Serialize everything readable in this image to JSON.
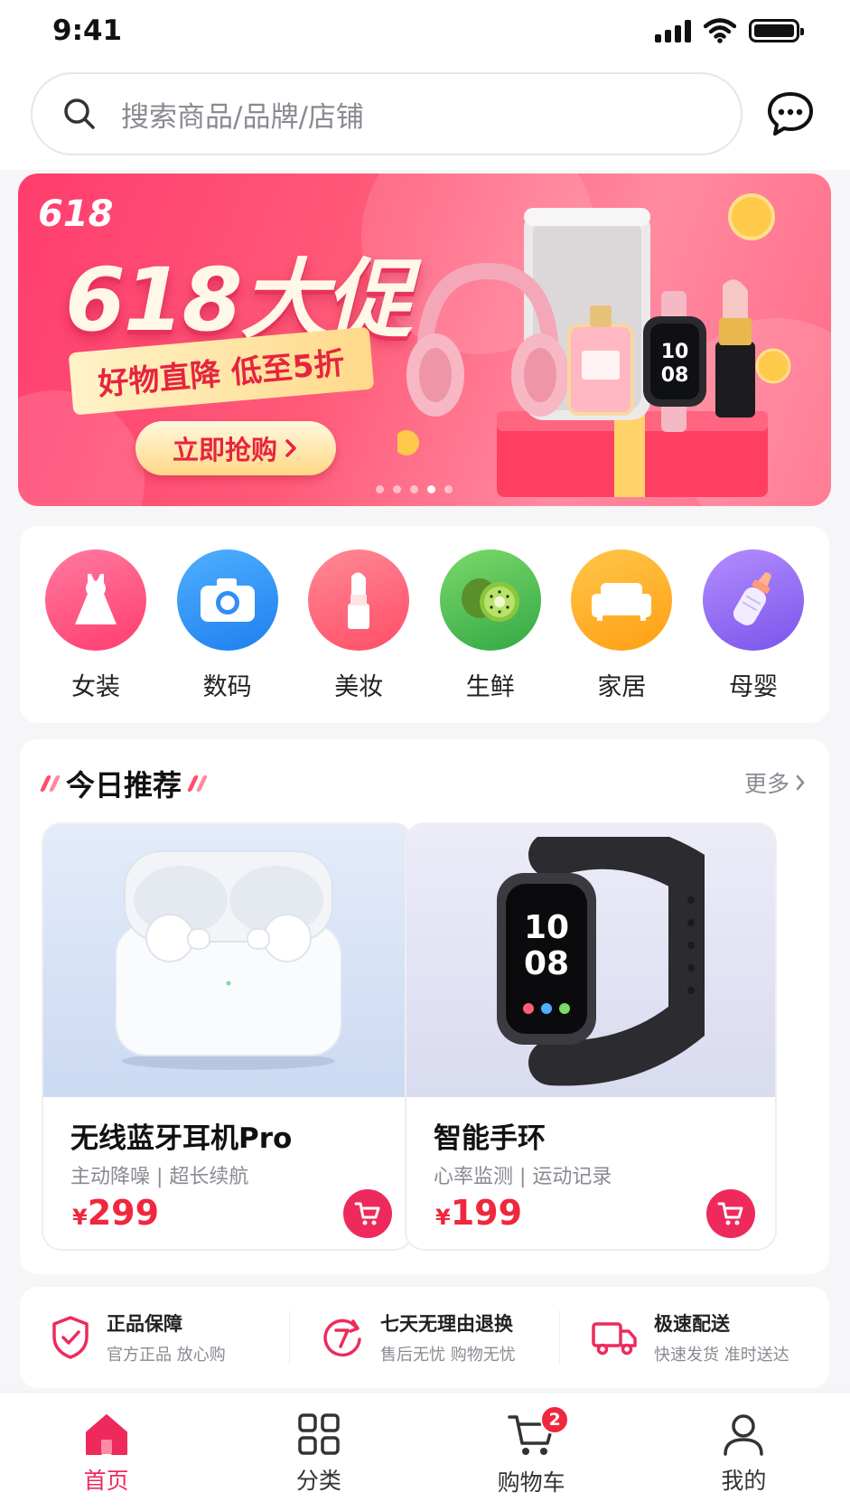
{
  "status_bar": {
    "time": "9:41"
  },
  "search": {
    "placeholder": "搜索商品/品牌/店铺"
  },
  "banner": {
    "tag": "618",
    "title": "618大促",
    "subtitle": "好物直降 低至5折",
    "cta": "立即抢购",
    "dot_count": 5,
    "active_dot": 3
  },
  "categories": [
    {
      "label": "女装",
      "icon": "dress-icon",
      "color": "#ff4d7a"
    },
    {
      "label": "数码",
      "icon": "camera-icon",
      "color": "#2f8ff5"
    },
    {
      "label": "美妆",
      "icon": "lipstick-icon",
      "color": "#ff5d74"
    },
    {
      "label": "生鲜",
      "icon": "kiwi-icon",
      "color": "#4fc35b"
    },
    {
      "label": "家居",
      "icon": "sofa-icon",
      "color": "#ffae1a"
    },
    {
      "label": "母婴",
      "icon": "baby-bottle-icon",
      "color": "#9b6cf2"
    }
  ],
  "recommend": {
    "title": "今日推荐",
    "more": "更多",
    "products": [
      {
        "name": "无线蓝牙耳机Pro",
        "tags": "主动降噪 | 超长续航",
        "currency": "¥",
        "price": "299"
      },
      {
        "name": "智能手环",
        "tags": "心率监测 | 运动记录",
        "currency": "¥",
        "price": "199"
      }
    ]
  },
  "guarantees": [
    {
      "title": "正品保障",
      "subtitle": "官方正品 放心购",
      "icon": "shield-check-icon"
    },
    {
      "title": "七天无理由退换",
      "subtitle": "售后无忧 购物无忧",
      "icon": "seven-day-icon"
    },
    {
      "title": "极速配送",
      "subtitle": "快速发货 准时送达",
      "icon": "truck-icon"
    }
  ],
  "tabs": [
    {
      "label": "首页",
      "icon": "home-icon",
      "active": true
    },
    {
      "label": "分类",
      "icon": "grid-icon",
      "active": false
    },
    {
      "label": "购物车",
      "icon": "cart-icon",
      "active": false,
      "badge": "2"
    },
    {
      "label": "我的",
      "icon": "user-icon",
      "active": false
    }
  ],
  "colors": {
    "accent": "#ee2a5c",
    "price": "#f0273d"
  }
}
